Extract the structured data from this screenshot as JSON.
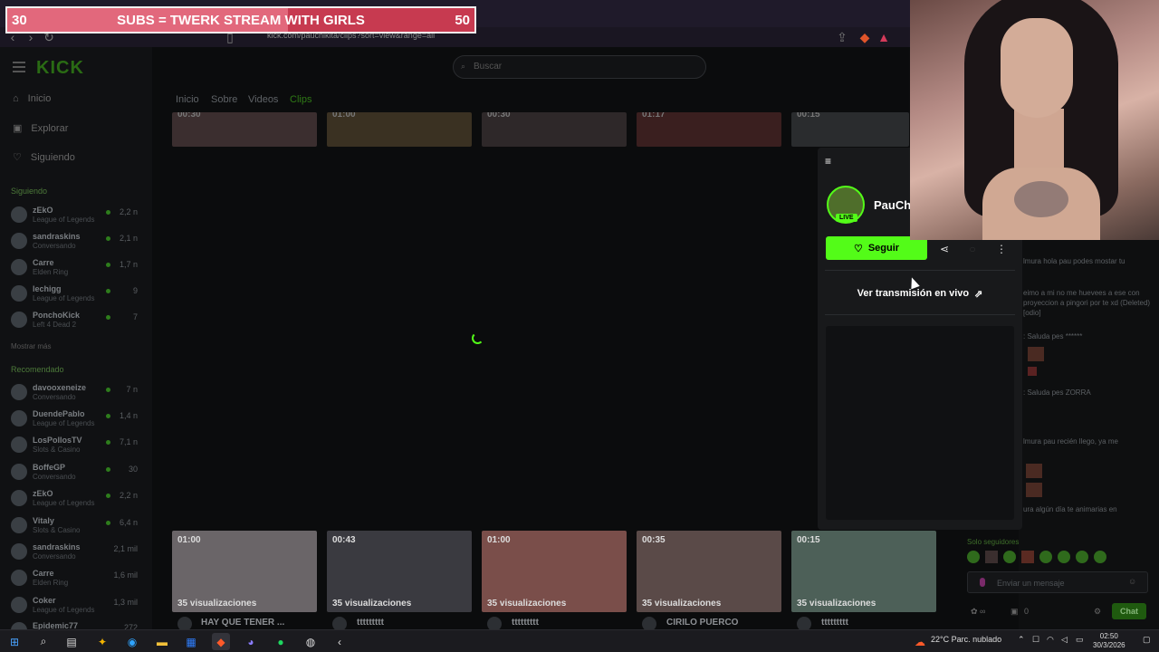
{
  "browser": {
    "url": "kick.com/pauchikita/clips?sort=view&range=all"
  },
  "overlay": {
    "left_count": "30",
    "text": "SUBS = TWERK STREAM WITH GIRLS",
    "right_count": "50",
    "progress": 0.6
  },
  "kick": {
    "logo": "KICK",
    "nav": [
      {
        "label": "Inicio",
        "icon": "home-icon"
      },
      {
        "label": "Explorar",
        "icon": "compass-icon"
      },
      {
        "label": "Siguiendo",
        "icon": "heart-icon"
      }
    ],
    "search_placeholder": "Buscar",
    "following_title": "Siguiendo",
    "following": [
      {
        "name": "zEkO",
        "category": "League of Legends",
        "viewers": "2,2 n"
      },
      {
        "name": "sandraskins",
        "category": "Conversando",
        "viewers": "2,1 n"
      },
      {
        "name": "Carre",
        "category": "Elden Ring",
        "viewers": "1,7 n"
      },
      {
        "name": "lechigg",
        "category": "League of Legends",
        "viewers": "9"
      },
      {
        "name": "PonchoKick",
        "category": "Left 4 Dead 2",
        "viewers": "7"
      }
    ],
    "show_more": "Mostrar más",
    "recommended_title": "Recomendado",
    "recommended": [
      {
        "name": "davooxeneize",
        "category": "Conversando",
        "viewers": "7 n"
      },
      {
        "name": "DuendePablo",
        "category": "League of Legends",
        "viewers": "1,4 n"
      },
      {
        "name": "LosPollosTV",
        "category": "Slots & Casino",
        "viewers": "7,1 n"
      },
      {
        "name": "BoffeGP",
        "category": "Conversando",
        "viewers": "30"
      },
      {
        "name": "zEkO",
        "category": "League of Legends",
        "viewers": "2,2 n"
      },
      {
        "name": "Vitaly",
        "category": "Slots & Casino",
        "viewers": "6,4 n"
      },
      {
        "name": "sandraskins",
        "category": "Conversando",
        "viewers": "2,1 mil"
      },
      {
        "name": "Carre",
        "category": "Elden Ring",
        "viewers": "1,6 mil"
      },
      {
        "name": "Coker",
        "category": "League of Legends",
        "viewers": "1,3 mil"
      },
      {
        "name": "Epidemic77",
        "category": "",
        "viewers": "272"
      }
    ],
    "tabs": [
      "Inicio",
      "Sobre",
      "Videos",
      "Clips"
    ],
    "active_tab": "Clips",
    "top_clips": [
      {
        "duration": "00:30"
      },
      {
        "duration": "01:00"
      },
      {
        "duration": "00:30"
      },
      {
        "duration": "01:17"
      },
      {
        "duration": "00:15"
      }
    ],
    "clips": [
      {
        "duration": "01:00",
        "views": "35 visualizaciones",
        "title": "HAY QUE TENER ...",
        "color": "#6a6568"
      },
      {
        "duration": "00:43",
        "views": "35 visualizaciones",
        "title": "ttttttttt",
        "color": "#3a3a40"
      },
      {
        "duration": "01:00",
        "views": "35 visualizaciones",
        "title": "ttttttttt",
        "color": "#7a4e4a"
      },
      {
        "duration": "00:35",
        "views": "35 visualizaciones",
        "title": "CIRILO PUERCO",
        "color": "#5a4a48"
      },
      {
        "duration": "00:15",
        "views": "35 visualizaciones",
        "title": "ttttttttt",
        "color": "#4d6058"
      }
    ]
  },
  "panel": {
    "channel": "PauCh",
    "live": "LIVE",
    "follow": "Seguir",
    "watch_live": "Ver transmisión en vivo"
  },
  "chat": {
    "messages": [
      {
        "text": "lmura hola pau podes mostar tu"
      },
      {
        "text": "eimo a mi no me huevees a ese con proyeccion a pingori por te xd (Deleted) [odio]"
      },
      {
        "user": "",
        "text": ": Saluda pes ******"
      },
      {
        "user": "",
        "text": ": Saluda pes ZORRA"
      },
      {
        "text": "lmura pau recién llego, ya me"
      },
      {
        "text": "ura algún día te animarias en"
      }
    ],
    "followers_only": "Solo seguidores",
    "input_placeholder": "Enviar un mensaje",
    "points": "0",
    "chat_button": "Chat"
  },
  "taskbar": {
    "weather": "22°C Parc. nublado",
    "time": "02:50",
    "date": "30/3/2026"
  }
}
